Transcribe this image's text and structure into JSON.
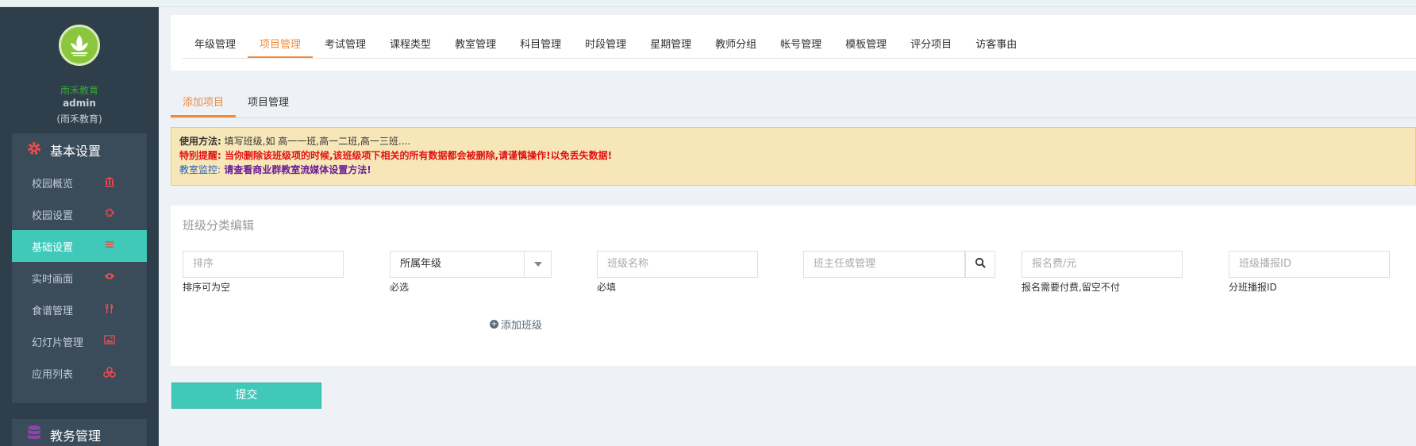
{
  "sidebar": {
    "brand": "雨禾教育",
    "user": "admin",
    "org": "(雨禾教育)",
    "group1": {
      "label": "基本设置",
      "icon": "gear-icon"
    },
    "items": [
      {
        "label": "校园概览",
        "icon": "bank-icon"
      },
      {
        "label": "校园设置",
        "icon": "cog-icon"
      },
      {
        "label": "基础设置",
        "icon": "list-icon"
      },
      {
        "label": "实时画面",
        "icon": "eye-icon"
      },
      {
        "label": "食谱管理",
        "icon": "cutlery-icon"
      },
      {
        "label": "幻灯片管理",
        "icon": "image-icon"
      },
      {
        "label": "应用列表",
        "icon": "cubes-icon"
      }
    ],
    "group2": {
      "label": "教务管理",
      "icon": "database-icon"
    }
  },
  "top_tabs": [
    "年级管理",
    "项目管理",
    "考试管理",
    "课程类型",
    "教室管理",
    "科目管理",
    "时段管理",
    "星期管理",
    "教师分组",
    "帐号管理",
    "模板管理",
    "评分项目",
    "访客事由"
  ],
  "sub_tabs": [
    "添加项目",
    "项目管理"
  ],
  "notice": {
    "usage_label": "使用方法:",
    "usage_text": "填写班级,如 高一一班,高一二班,高一三班....",
    "warning": "特别提醒: 当你删除该班级项的时候,该班级项下相关的所有数据都会被删除,请谨慎操作!以免丢失数据!",
    "monitor_label": "教室监控:",
    "monitor_text": "请查看商业群教室流媒体设置方法!"
  },
  "form": {
    "title": "班级分类编辑",
    "sort_placeholder": "排序",
    "sort_hint": "排序可为空",
    "grade_select": "所属年级",
    "grade_hint": "必选",
    "name_placeholder": "班级名称",
    "name_hint": "必填",
    "teacher_placeholder": "班主任或管理",
    "fee_placeholder": "报名费/元",
    "fee_hint": "报名需要付费,留空不付",
    "stream_placeholder": "班级播报ID",
    "stream_hint": "分班播报ID",
    "add_class": "添加班级"
  },
  "submit_label": "提交",
  "colors": {
    "accent": "#40c9b9",
    "active_tab": "#f08b3c",
    "sidebar_bg": "#2f3e4b"
  }
}
